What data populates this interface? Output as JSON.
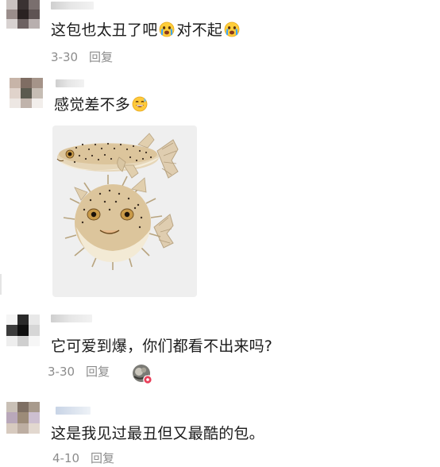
{
  "comments": [
    {
      "text_before": "这包也太丑了吧",
      "text_middle": "对不起",
      "emoji": "crying-face",
      "date": "3-30",
      "reply_label": "回复"
    },
    {
      "text": "感觉差不多",
      "emoji": "grinning-sweat-face",
      "image": "pufferfish-photo"
    },
    {
      "text": "它可爱到爆，你们都看不出来吗?",
      "date": "3-30",
      "reply_label": "回复",
      "sticker": "avatar-badge-sticker"
    },
    {
      "text": "这是我见过最丑但又最酷的包。",
      "date": "4-10",
      "reply_label": "回复"
    }
  ],
  "colors": {
    "text": "#1b1b1b",
    "meta": "#8c8c8c",
    "image_bg": "#efefef",
    "badge": "#e8405a"
  }
}
